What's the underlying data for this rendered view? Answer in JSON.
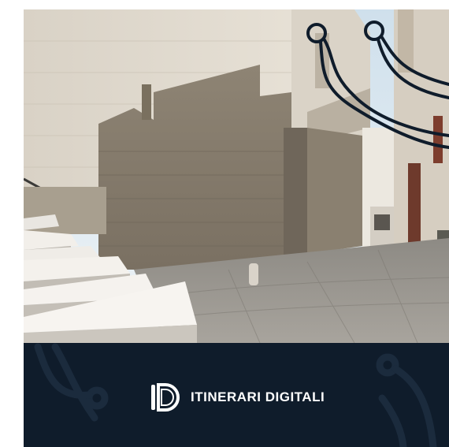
{
  "brand": {
    "name": "ITINERARI DIGITALI",
    "logo_icon": "id-monogram-icon"
  },
  "colors": {
    "banner_background": "#0f1c2b",
    "circuit_lines": "#0f1c2b",
    "text": "#ffffff"
  },
  "photo": {
    "subject": "stone alley with steps"
  }
}
